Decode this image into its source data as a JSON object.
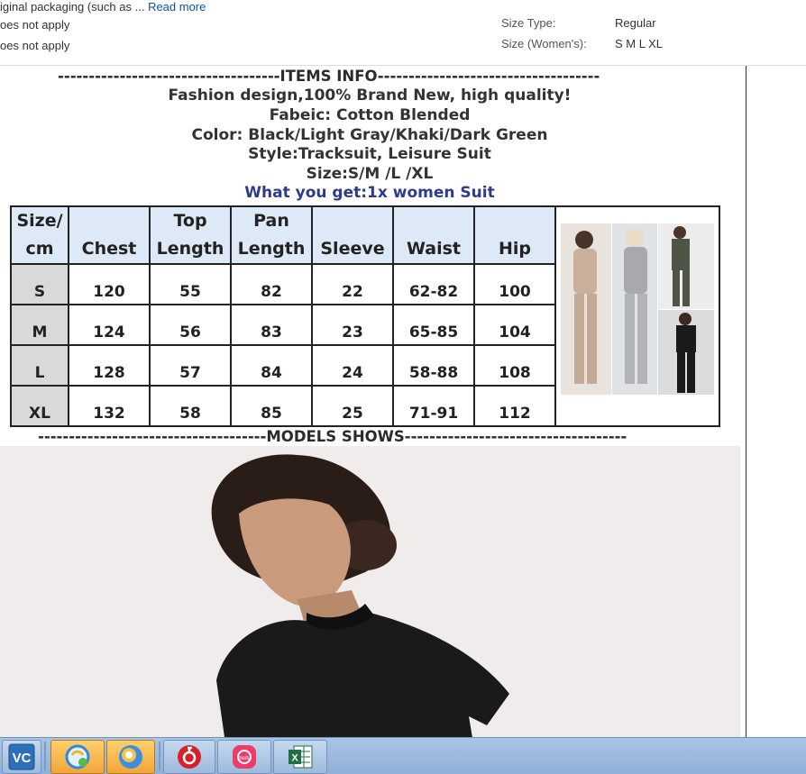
{
  "specifics": {
    "row1_left": "iginal packaging (such as ...",
    "read_more": "Read more",
    "row2_left": "oes not apply",
    "row3_left": "oes not apply",
    "size_type_label": "Size Type:",
    "size_type_value": "Regular",
    "size_label": "Size (Women's):",
    "size_value": "S M L XL"
  },
  "description": {
    "items_info_heading": "------------------------------------ITEMS INFO------------------------------------",
    "lines": [
      "Fashion design,100% Brand New, high quality!",
      "Fabeic: Cotton Blended",
      "Color: Black/Light Gray/Khaki/Dark Green",
      "Style:Tracksuit, Leisure Suit",
      "Size:S/M /L /XL"
    ],
    "what_you_get": "What you get:1x women Suit",
    "models_heading": "-------------------------------------MODELS SHOWS------------------------------------"
  },
  "size_chart": {
    "headers": [
      {
        "top": "Size/",
        "bottom": "cm"
      },
      {
        "top": "",
        "bottom": "Chest"
      },
      {
        "top": "Top",
        "bottom": "Length"
      },
      {
        "top": "Pan",
        "bottom": "Length"
      },
      {
        "top": "",
        "bottom": "Sleeve"
      },
      {
        "top": "",
        "bottom": "Waist"
      },
      {
        "top": "",
        "bottom": "Hip"
      }
    ],
    "rows": [
      [
        "S",
        "120",
        "55",
        "82",
        "22",
        "62-82",
        "100"
      ],
      [
        "M",
        "124",
        "56",
        "83",
        "23",
        "65-85",
        "104"
      ],
      [
        "L",
        "128",
        "57",
        "84",
        "24",
        "58-88",
        "108"
      ],
      [
        "XL",
        "132",
        "58",
        "85",
        "25",
        "71-91",
        "112"
      ]
    ]
  },
  "taskbar": {
    "items": [
      "vnc-viewer",
      "qq-browser",
      "sogou-browser",
      "netease-music",
      "meitu",
      "excel"
    ]
  },
  "colors": {
    "header_fill": "#dde9f6",
    "size_fill": "#d9d9d9",
    "link_blue": "#0654ba",
    "title_blue": "#2e3a8c",
    "taskbar": "#a9c5e4"
  }
}
